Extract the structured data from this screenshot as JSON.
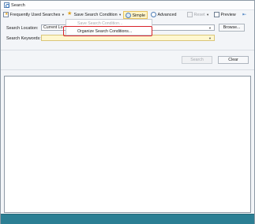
{
  "window": {
    "title": "Search",
    "statusbar_color": "#2c7f94"
  },
  "toolbar": {
    "frequent_searches": {
      "label": "Frequently Used Searches",
      "icon": "star-list-icon"
    },
    "save_condition": {
      "label": "Save Search Condition",
      "icon": "save-star-icon"
    },
    "simple": {
      "label": "Simple",
      "icon": "simple-search-icon"
    },
    "advanced": {
      "label": "Advanced",
      "icon": "advanced-search-icon"
    },
    "reset": {
      "label": "Reset",
      "icon": "reset-icon"
    },
    "preview": {
      "label": "Preview",
      "icon": "preview-icon"
    },
    "pin_icon": "pin-icon"
  },
  "save_menu": {
    "items": [
      {
        "label": "Save Search Condition...",
        "enabled": false
      },
      {
        "label": "Organize Search Conditions...",
        "enabled": true
      }
    ],
    "highlight_color": "#d8232a"
  },
  "form": {
    "location_label": "Search Location:",
    "location_value": "Current Lo",
    "browse_button": "Browse...",
    "keyword_label": "Search Keywords:",
    "keyword_value": "",
    "search_button": "Search",
    "clear_button": "Clear"
  }
}
